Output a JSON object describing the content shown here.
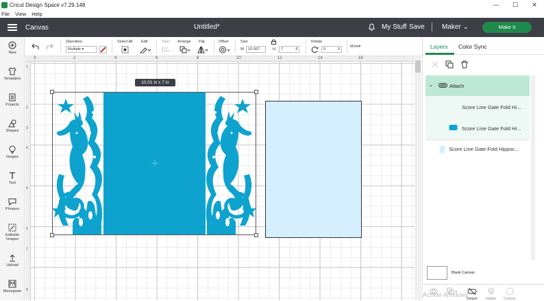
{
  "window": {
    "app_title": "Cricut Design Space  v7.29.148",
    "controls": [
      "—",
      "☐",
      "✕"
    ]
  },
  "menu": [
    "File",
    "View",
    "Help"
  ],
  "header": {
    "canvas_label": "Canvas",
    "doc_title": "Untitled*",
    "my_stuff": "My Stuff",
    "save": "Save",
    "machine": "Maker",
    "make_it": "Make It"
  },
  "leftbar": [
    "New",
    "Templates",
    "Projects",
    "Shapes",
    "Images",
    "Text",
    "Phrases",
    "Editable Images",
    "Upload",
    "Monogram"
  ],
  "toolbar": {
    "operation_label": "Operation",
    "operation_value": "Multiple",
    "select_all": "Select All",
    "edit": "Edit",
    "align": "Align",
    "arrange": "Arrange",
    "flip": "Flip",
    "offset": "Offset",
    "size": "Size",
    "w_label": "W",
    "w_value": "10.007",
    "h_label": "H",
    "h_value": "7",
    "rotate": "Rotate",
    "rotate_value": "0",
    "more": "More▾"
  },
  "ruler": {
    "h": [
      "3",
      "2",
      "4",
      "6",
      "8",
      "10",
      "12",
      "14",
      "16"
    ],
    "v": [
      "1",
      "2",
      "3",
      "4",
      "5",
      "6",
      "7",
      "8"
    ]
  },
  "canvas": {
    "size_tooltip": "10.01  in x 7  in"
  },
  "layers": {
    "tabs": [
      "Layers",
      "Color Sync"
    ],
    "attach_label": "Attach",
    "items": [
      "Score Line Gate Fold Hi...",
      "Score Line Gate Fold Hi...",
      "Score Line Gate Fold Hippoc..."
    ],
    "blank_canvas": "Blank Canvas",
    "bottom_tools": [
      "",
      "",
      "Detach",
      "Flatten",
      "Contour"
    ],
    "watermark": "Activar Windows"
  },
  "colors": {
    "accent": "#1f8a4c",
    "design": "#0ea3cf",
    "blank_panel": "#d4efff",
    "header": "#3c3f45"
  }
}
